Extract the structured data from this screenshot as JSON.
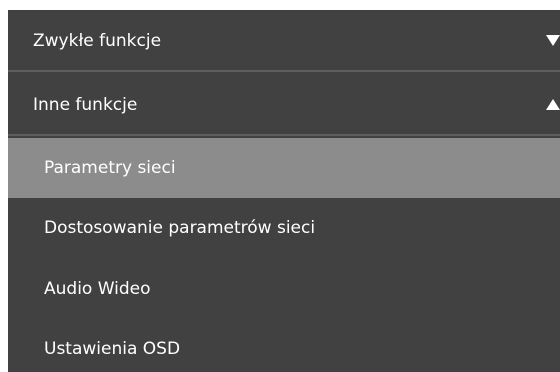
{
  "menu": {
    "sections": [
      {
        "label": "Zwykłe funkcje",
        "expanded": false,
        "arrow_icon": "triangle-down-icon"
      },
      {
        "label": "Inne funkcje",
        "expanded": true,
        "arrow_icon": "triangle-up-icon"
      }
    ],
    "sub_items": [
      {
        "label": "Parametry sieci",
        "active": true
      },
      {
        "label": "Dostosowanie parametrów sieci",
        "active": false
      },
      {
        "label": "Audio Wideo",
        "active": false
      },
      {
        "label": "Ustawienia OSD",
        "active": false
      }
    ],
    "colors": {
      "background": "#414141",
      "active_background": "#8c8c8c",
      "divider": "#5e5e5e",
      "text": "#ffffff"
    }
  }
}
